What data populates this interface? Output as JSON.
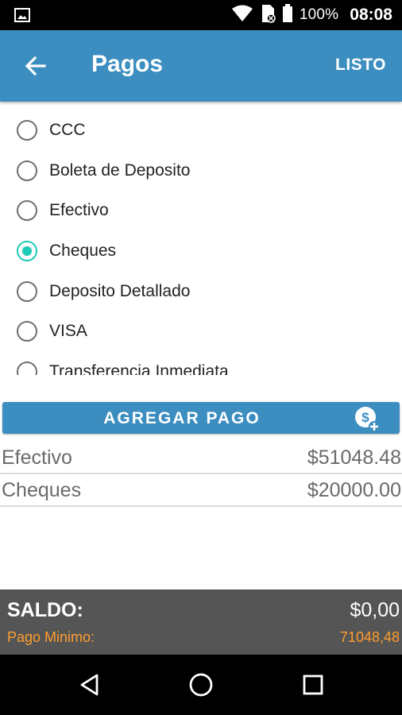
{
  "status_bar": {
    "battery_percent": "100%",
    "time": "08:08",
    "icons": [
      "image-icon",
      "wifi-icon",
      "sim-card-icon",
      "battery-icon"
    ]
  },
  "app_bar": {
    "title": "Pagos",
    "action": "LISTO",
    "back_icon": "arrow-left-icon"
  },
  "payment_options": {
    "items": [
      {
        "label": "CCC",
        "checked": false
      },
      {
        "label": "Boleta de Deposito",
        "checked": false
      },
      {
        "label": "Efectivo",
        "checked": false
      },
      {
        "label": "Cheques",
        "checked": true
      },
      {
        "label": "Deposito Detallado",
        "checked": false
      },
      {
        "label": "VISA",
        "checked": false
      },
      {
        "label": "Transferencia Inmediata",
        "checked": false
      }
    ]
  },
  "add_payment": {
    "label": "AGREGAR PAGO",
    "icon": "add-money-icon"
  },
  "payments": [
    {
      "name": "Efectivo",
      "amount": "$51048.48"
    },
    {
      "name": "Cheques",
      "amount": "$20000.00"
    }
  ],
  "summary": {
    "saldo_label": "SALDO:",
    "saldo_value": "$0,00",
    "minimum_label": "Pago Minimo:",
    "minimum_value": "71048,48"
  },
  "colors": {
    "primary": "#3c8dc0",
    "accent": "#1ecbb6",
    "summary_bg": "#555555",
    "minimum_text": "#ff9d2e"
  },
  "nav_bar": {
    "icons": [
      "back-triangle-icon",
      "home-circle-icon",
      "recents-square-icon"
    ]
  }
}
